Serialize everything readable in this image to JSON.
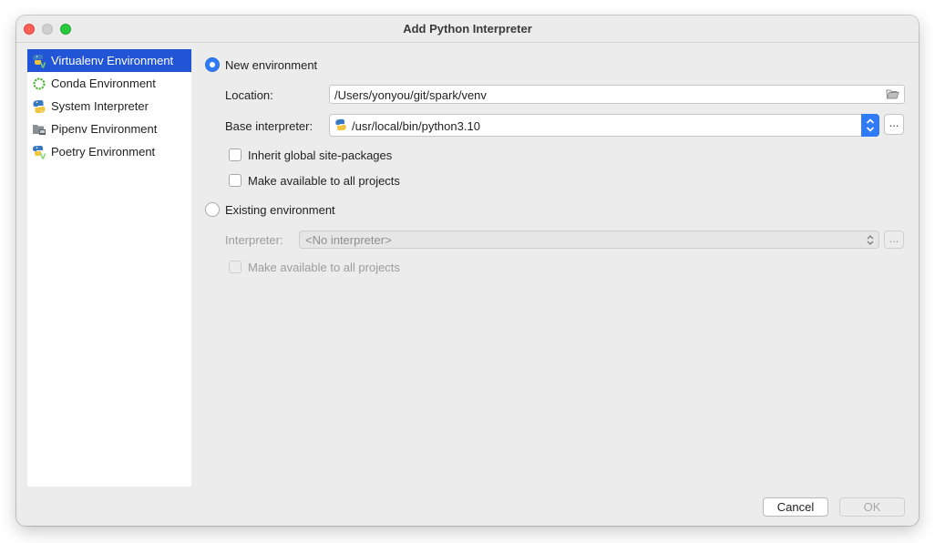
{
  "window": {
    "title": "Add Python Interpreter"
  },
  "sidebar": {
    "items": [
      {
        "label": "Virtualenv Environment",
        "icon": "virtualenv-icon",
        "selected": true
      },
      {
        "label": "Conda Environment",
        "icon": "conda-icon",
        "selected": false
      },
      {
        "label": "System Interpreter",
        "icon": "python-icon",
        "selected": false
      },
      {
        "label": "Pipenv Environment",
        "icon": "pipenv-icon",
        "selected": false
      },
      {
        "label": "Poetry Environment",
        "icon": "poetry-icon",
        "selected": false
      }
    ]
  },
  "new_env": {
    "radio_label": "New environment",
    "selected": true,
    "location_label": "Location:",
    "location_value": "/Users/yonyou/git/spark/venv",
    "base_label": "Base interpreter:",
    "base_value": "/usr/local/bin/python3.10",
    "browse_label": "...",
    "inherit_label": "Inherit global site-packages",
    "inherit_checked": false,
    "make_available_label": "Make available to all projects",
    "make_available_checked": false
  },
  "existing_env": {
    "radio_label": "Existing environment",
    "selected": false,
    "interpreter_label": "Interpreter:",
    "interpreter_value": "<No interpreter>",
    "browse_label": "...",
    "make_available_label": "Make available to all projects"
  },
  "footer": {
    "cancel_label": "Cancel",
    "ok_label": "OK"
  },
  "colors": {
    "accent": "#2f7af5",
    "selection": "#2155d6",
    "close": "#fe5f57",
    "maximize": "#28c840"
  }
}
